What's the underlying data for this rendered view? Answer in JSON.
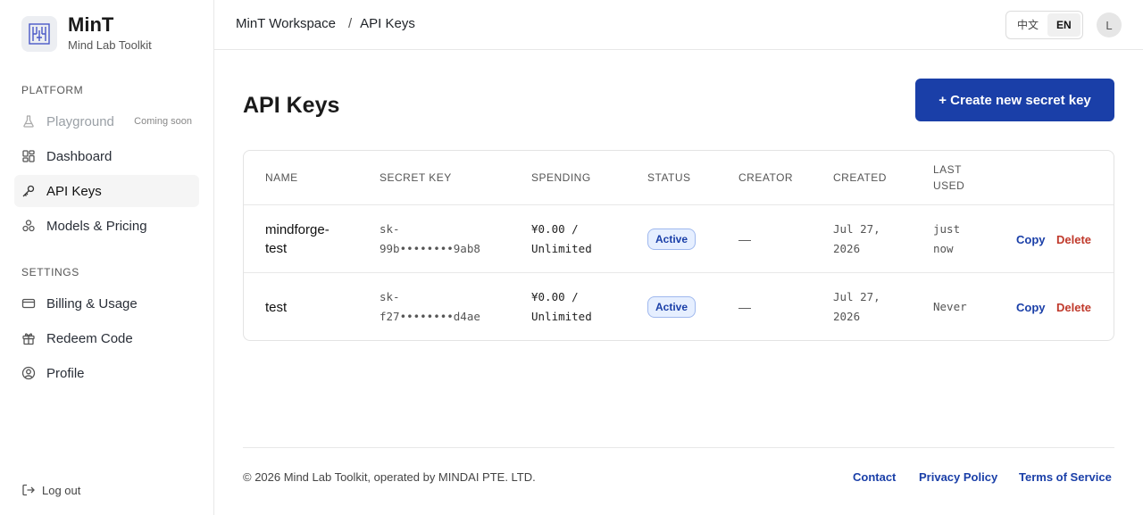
{
  "brand": {
    "name": "MinT",
    "subtitle": "Mind Lab Toolkit"
  },
  "sidebar": {
    "platform_label": "PLATFORM",
    "settings_label": "SETTINGS",
    "platform_items": [
      {
        "label": "Playground",
        "badge": "Coming soon",
        "icon": "flask-icon",
        "disabled": true
      },
      {
        "label": "Dashboard",
        "icon": "dashboard-icon"
      },
      {
        "label": "API Keys",
        "icon": "key-icon",
        "active": true
      },
      {
        "label": "Models & Pricing",
        "icon": "models-icon"
      }
    ],
    "settings_items": [
      {
        "label": "Billing & Usage",
        "icon": "credit-card-icon"
      },
      {
        "label": "Redeem Code",
        "icon": "gift-icon"
      },
      {
        "label": "Profile",
        "icon": "user-circle-icon"
      }
    ],
    "logout_label": "Log out"
  },
  "header": {
    "breadcrumb": {
      "workspace": "MinT Workspace",
      "separator": "/",
      "current": "API Keys"
    },
    "lang_zh": "中文",
    "lang_en": "EN",
    "avatar_initial": "L"
  },
  "main": {
    "title": "API Keys",
    "create_button": "+ Create new secret key",
    "columns": {
      "name": "NAME",
      "secret_key": "SECRET KEY",
      "spending": "SPENDING",
      "status": "STATUS",
      "creator": "CREATOR",
      "created": "CREATED",
      "last_used_1": "LAST",
      "last_used_2": "USED"
    },
    "rows": [
      {
        "name_1": "mindforge-",
        "name_2": "test",
        "key_1": "sk-",
        "key_2": "99b••••••••9ab8",
        "spend_1": "¥0.00 /",
        "spend_2": "Unlimited",
        "status": "Active",
        "creator": "—",
        "created_1": "Jul 27,",
        "created_2": "2026",
        "last_1": "just",
        "last_2": "now",
        "copy": "Copy",
        "delete": "Delete"
      },
      {
        "name_1": "test",
        "name_2": "",
        "key_1": "sk-",
        "key_2": "f27••••••••d4ae",
        "spend_1": "¥0.00 /",
        "spend_2": "Unlimited",
        "status": "Active",
        "creator": "—",
        "created_1": "Jul 27,",
        "created_2": "2026",
        "last_1": "Never",
        "last_2": "",
        "copy": "Copy",
        "delete": "Delete"
      }
    ]
  },
  "footer": {
    "copyright": "© 2026 Mind Lab Toolkit, operated by MINDAI PTE. LTD.",
    "contact": "Contact",
    "privacy": "Privacy Policy",
    "terms": "Terms of Service"
  },
  "colors": {
    "accent": "#1a3fa8",
    "danger": "#c0392b",
    "badge_bg": "#e6efff"
  }
}
